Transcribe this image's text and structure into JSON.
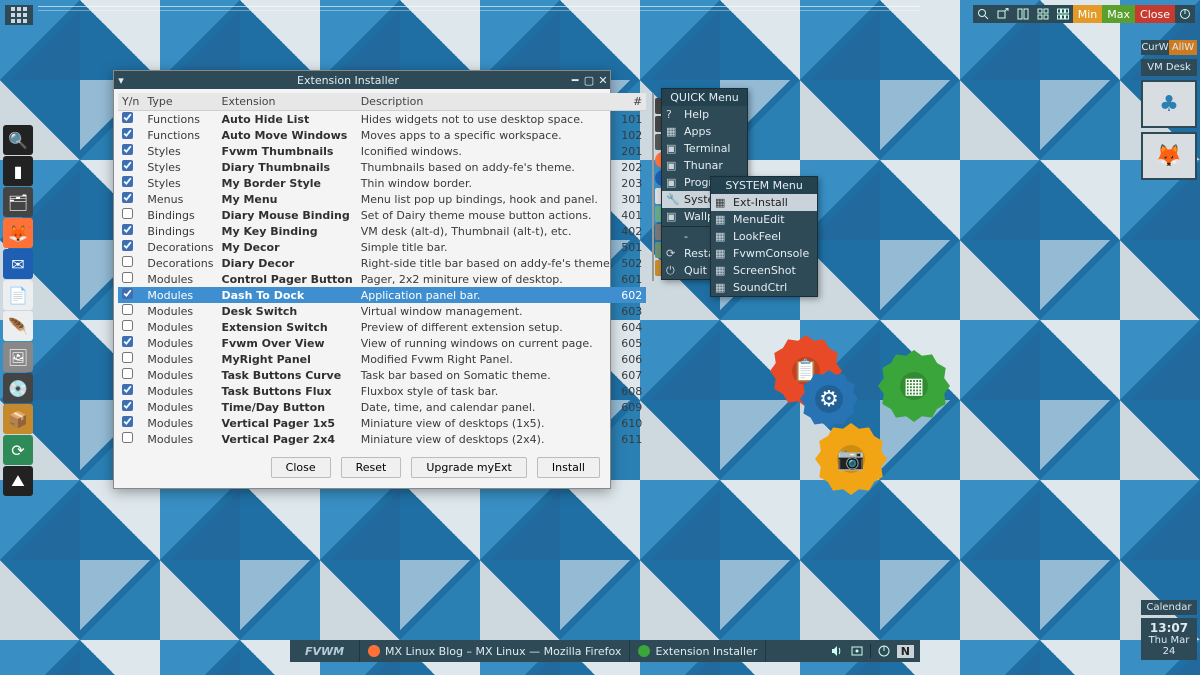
{
  "top_ops": {
    "min": "Min",
    "max": "Max",
    "close": "Close"
  },
  "rpanel": {
    "curw": "CurW",
    "allw": "AllW",
    "vmdesk": "VM Desk",
    "calendar": "Calendar",
    "time": "13:07",
    "date": "Thu Mar 24"
  },
  "taskbar": {
    "logo": "FVWM",
    "tasks": [
      {
        "label": "MX Linux Blog – MX Linux — Mozilla Firefox",
        "color": "#ff7139"
      },
      {
        "label": "Extension Installer",
        "color": "#3aa53a"
      }
    ],
    "tray_letter": "N"
  },
  "win": {
    "title": "Extension Installer",
    "headers": {
      "yn": "Y/n",
      "type": "Type",
      "ext": "Extension",
      "desc": "Description",
      "num": "#"
    },
    "buttons": {
      "close": "Close",
      "reset": "Reset",
      "upgrade": "Upgrade myExt",
      "install": "Install"
    },
    "rows": [
      {
        "on": true,
        "type": "Functions",
        "ext": "Auto Hide List",
        "desc": "Hides widgets not to use desktop space.",
        "num": 101
      },
      {
        "on": true,
        "type": "Functions",
        "ext": "Auto Move Windows",
        "desc": "Moves apps to a specific workspace.",
        "num": 102
      },
      {
        "on": true,
        "type": "Styles",
        "ext": "Fvwm Thumbnails",
        "desc": "Iconified windows.",
        "num": 201
      },
      {
        "on": true,
        "type": "Styles",
        "ext": "Diary Thumbnails",
        "desc": "Thumbnails based on addy-fe's theme.",
        "num": 202
      },
      {
        "on": true,
        "type": "Styles",
        "ext": "My Border Style",
        "desc": "Thin window border.",
        "num": 203
      },
      {
        "on": true,
        "type": "Menus",
        "ext": "My Menu",
        "desc": "Menu list pop up bindings, hook and panel.",
        "num": 301
      },
      {
        "on": false,
        "type": "Bindings",
        "ext": "Diary Mouse Binding",
        "desc": "Set of Dairy theme mouse button actions.",
        "num": 401
      },
      {
        "on": true,
        "type": "Bindings",
        "ext": "My Key Binding",
        "desc": "VM desk (alt-d), Thumbnail (alt-t), etc.",
        "num": 402
      },
      {
        "on": true,
        "type": "Decorations",
        "ext": "My Decor",
        "desc": "Simple title bar.",
        "num": 501
      },
      {
        "on": false,
        "type": "Decorations",
        "ext": "Diary Decor",
        "desc": "Right-side title bar based on addy-fe's theme.",
        "num": 502
      },
      {
        "on": false,
        "type": "Modules",
        "ext": "Control Pager Button",
        "desc": "Pager, 2x2 miniture view of desktop.",
        "num": 601
      },
      {
        "on": true,
        "type": "Modules",
        "ext": "Dash To Dock",
        "desc": "Application panel bar.",
        "num": 602,
        "sel": true
      },
      {
        "on": false,
        "type": "Modules",
        "ext": "Desk Switch",
        "desc": "Virtual window management.",
        "num": 603
      },
      {
        "on": false,
        "type": "Modules",
        "ext": "Extension Switch",
        "desc": "Preview of different extension setup.",
        "num": 604
      },
      {
        "on": true,
        "type": "Modules",
        "ext": "Fvwm Over View",
        "desc": "View of running windows on current page.",
        "num": 605
      },
      {
        "on": false,
        "type": "Modules",
        "ext": "MyRight Panel",
        "desc": "Modified Fvwm Right Panel.",
        "num": 606
      },
      {
        "on": false,
        "type": "Modules",
        "ext": "Task Buttons Curve",
        "desc": "Task bar based on Somatic theme.",
        "num": 607
      },
      {
        "on": true,
        "type": "Modules",
        "ext": "Task Buttons Flux",
        "desc": "Fluxbox style of task bar.",
        "num": 608
      },
      {
        "on": true,
        "type": "Modules",
        "ext": "Time/Day Button",
        "desc": "Date, time, and calendar panel.",
        "num": 609
      },
      {
        "on": true,
        "type": "Modules",
        "ext": "Vertical Pager 1x5",
        "desc": "Miniature view of desktops (1x5).",
        "num": 610
      },
      {
        "on": false,
        "type": "Modules",
        "ext": "Vertical Pager 2x4",
        "desc": "Miniature view of desktops (2x4).",
        "num": 611
      }
    ]
  },
  "quick_menu": {
    "header": "QUICK Menu",
    "items": [
      {
        "label": "Help"
      },
      {
        "label": "Apps"
      },
      {
        "label": "Terminal"
      },
      {
        "label": "Thunar"
      },
      {
        "label": "Programs",
        "sub": true
      },
      {
        "label": "System",
        "sub": true,
        "hover": true
      },
      {
        "label": "Wallpaper",
        "sub": true
      },
      {
        "label": "-"
      },
      {
        "label": "Restart"
      },
      {
        "label": "Quit"
      }
    ]
  },
  "system_menu": {
    "header": "SYSTEM Menu",
    "items": [
      {
        "label": "Ext-Install",
        "hover": true
      },
      {
        "label": "MenuEdit"
      },
      {
        "label": "LookFeel"
      },
      {
        "label": "FvwmConsole"
      },
      {
        "label": "ScreenShot"
      },
      {
        "label": "SoundCtrl"
      }
    ]
  },
  "dock_icons": [
    "search",
    "terminal",
    "file-manager",
    "firefox",
    "thunderbird",
    "writer",
    "text-editor",
    "image-viewer",
    "snapshot",
    "package-installer",
    "sync",
    "mx-tools"
  ]
}
